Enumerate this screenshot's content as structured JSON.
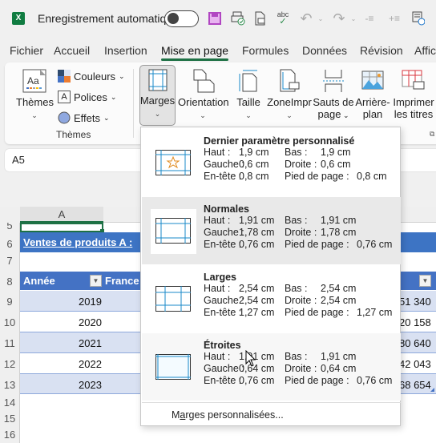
{
  "titlebar": {
    "app_icon": "excel-logo",
    "autosave_label": "Enregistrement automatique",
    "autosave_state": "off",
    "quick_access_icons": [
      "save-icon",
      "print-preview-icon",
      "page-setup-icon",
      "spelling-icon",
      "undo-icon",
      "redo-icon",
      "decrease-indent-icon",
      "increase-indent-icon",
      "calculate-icon"
    ]
  },
  "tabs": [
    {
      "label": "Fichier",
      "active": false
    },
    {
      "label": "Accueil",
      "active": false
    },
    {
      "label": "Insertion",
      "active": false
    },
    {
      "label": "Mise en page",
      "active": true
    },
    {
      "label": "Formules",
      "active": false
    },
    {
      "label": "Données",
      "active": false
    },
    {
      "label": "Révision",
      "active": false
    },
    {
      "label": "Affic",
      "active": false
    }
  ],
  "ribbon": {
    "themes_group": {
      "label": "Thèmes",
      "themes_button": "Thèmes",
      "couleurs": "Couleurs",
      "polices": "Polices",
      "effets": "Effets"
    },
    "page_setup": {
      "marges": "Marges",
      "orientation": "Orientation",
      "taille": "Taille",
      "zone_impr": "ZoneImpr",
      "sauts_line1": "Sauts de",
      "sauts_line2": "page",
      "arriere_line1": "Arrière-",
      "arriere_line2": "plan",
      "imprimer_line1": "Imprimer",
      "imprimer_line2": "les titres"
    }
  },
  "namebox": {
    "value": "A5"
  },
  "sheet": {
    "column_header": "A",
    "rows": [
      "5",
      "6",
      "7",
      "8",
      "9",
      "10",
      "11",
      "12",
      "13",
      "14",
      "15",
      "16"
    ],
    "title": "Ventes de produits A :",
    "table_headers": [
      "Année",
      "France"
    ],
    "years": [
      "2019",
      "2020",
      "2021",
      "2022",
      "2023"
    ],
    "right_values": [
      "51 340",
      "20 158",
      "80 640",
      "42 043",
      "68 654"
    ],
    "header_color": "#4472c4",
    "band_color": "#d9e1f2"
  },
  "margins_menu": {
    "labels": {
      "haut": "Haut :",
      "bas": "Bas :",
      "gauche": "Gauche :",
      "droite": "Droite :",
      "entete": "En-tête :",
      "pied": "Pied de page :"
    },
    "items": [
      {
        "name": "Dernier paramètre personnalisé",
        "icon": "custom-margins-star-icon",
        "haut": "1,9 cm",
        "bas": "1,9 cm",
        "gauche": "0,6 cm",
        "droite": "0,6 cm",
        "entete": "0,8 cm",
        "pied": "0,8 cm"
      },
      {
        "name": "Normales",
        "icon": "normal-margins-icon",
        "haut": "1,91 cm",
        "bas": "1,91 cm",
        "gauche": "1,78 cm",
        "droite": "1,78 cm",
        "entete": "0,76 cm",
        "pied": "0,76 cm",
        "selected": true
      },
      {
        "name": "Larges",
        "icon": "wide-margins-icon",
        "haut": "2,54 cm",
        "bas": "2,54 cm",
        "gauche": "2,54 cm",
        "droite": "2,54 cm",
        "entete": "1,27 cm",
        "pied": "1,27 cm"
      },
      {
        "name": "Étroites",
        "icon": "narrow-margins-icon",
        "haut": "1,91 cm",
        "bas": "1,91 cm",
        "gauche": "0,64 cm",
        "droite": "0,64 cm",
        "entete": "0,76 cm",
        "pied": "0,76 cm",
        "hovered": true
      }
    ],
    "custom_prefix": "M",
    "custom_accel": "a",
    "custom_suffix": "rges personnalisées..."
  }
}
